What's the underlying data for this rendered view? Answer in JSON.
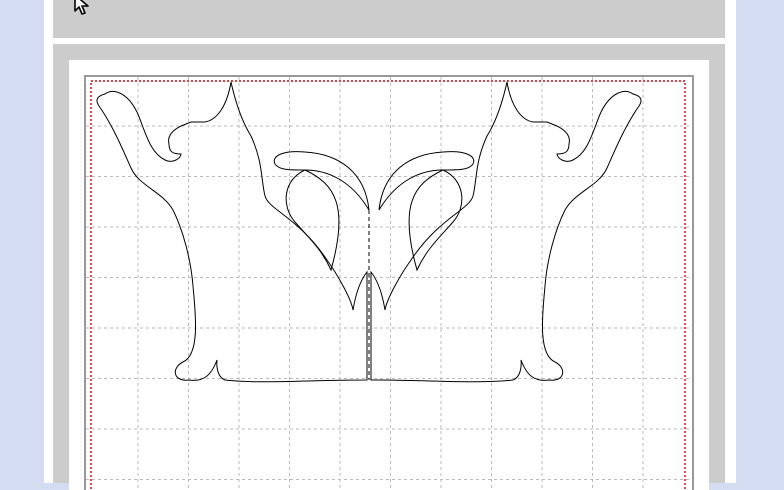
{
  "icons": {
    "cursor": "mouse-pointer-icon"
  },
  "colors": {
    "sidebar_bg": "#d3dcf0",
    "panel_bg": "#cccccc",
    "mat_bg": "#ffffff",
    "grid_line": "#bbbbbb",
    "cut_boundary": "#e00000",
    "mat_border": "#999999",
    "design_stroke": "#000000"
  },
  "canvas": {
    "grid": true,
    "boundary_style": "dotted-red",
    "fold_line": "dashed"
  }
}
